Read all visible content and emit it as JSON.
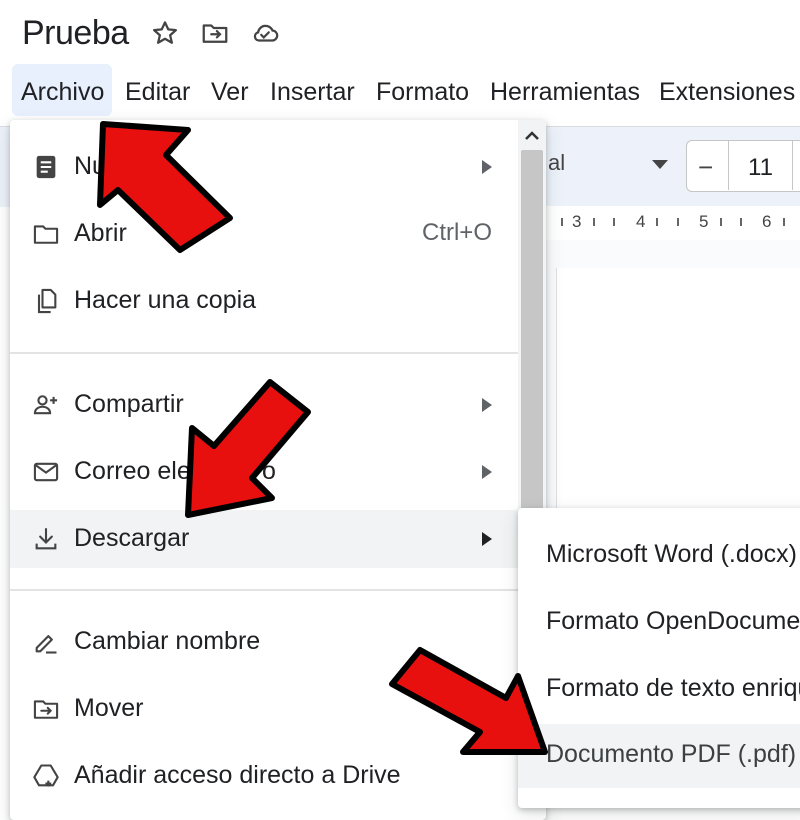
{
  "document": {
    "title": "Prueba"
  },
  "title_icons": [
    "star-icon",
    "move-to-folder-icon",
    "cloud-saved-icon"
  ],
  "menubar": [
    {
      "label": "Archivo"
    },
    {
      "label": "Editar"
    },
    {
      "label": "Ver"
    },
    {
      "label": "Insertar"
    },
    {
      "label": "Formato"
    },
    {
      "label": "Herramientas"
    },
    {
      "label": "Extensiones"
    }
  ],
  "toolbar": {
    "font_partial": "al",
    "size_minus": "−",
    "font_size": "11"
  },
  "ruler": [
    "3",
    "4",
    "5",
    "6"
  ],
  "file_menu": {
    "items": [
      {
        "label": "Nu",
        "icon": "document-icon",
        "submenu": true
      },
      {
        "label": "Abrir",
        "icon": "folder-icon",
        "shortcut": "Ctrl+O"
      },
      {
        "label": "Hacer una copia",
        "icon": "copy-icon"
      },
      {
        "label": "Compartir",
        "icon": "add-person-icon",
        "submenu": true
      },
      {
        "label": "Correo ele",
        "label_tail": "o",
        "icon": "mail-icon",
        "submenu": true
      },
      {
        "label": "Descargar",
        "icon": "download-icon",
        "submenu": true,
        "active": true
      },
      {
        "label": "Cambiar nombre",
        "icon": "rename-icon"
      },
      {
        "label": "Mover",
        "icon": "move-icon"
      },
      {
        "label": "Añadir acceso directo a Drive",
        "icon": "drive-shortcut-icon"
      }
    ]
  },
  "download_submenu": {
    "items": [
      {
        "label": "Microsoft Word (.docx)"
      },
      {
        "label": "Formato OpenDocumen"
      },
      {
        "label": "Formato de texto enriqu"
      },
      {
        "label": "Documento PDF (.pdf)",
        "active": true
      }
    ]
  },
  "colors": {
    "annotation_arrow": "#e8100f",
    "menu_highlight": "#e8f0fe",
    "hover_bg": "#f1f3f4"
  }
}
